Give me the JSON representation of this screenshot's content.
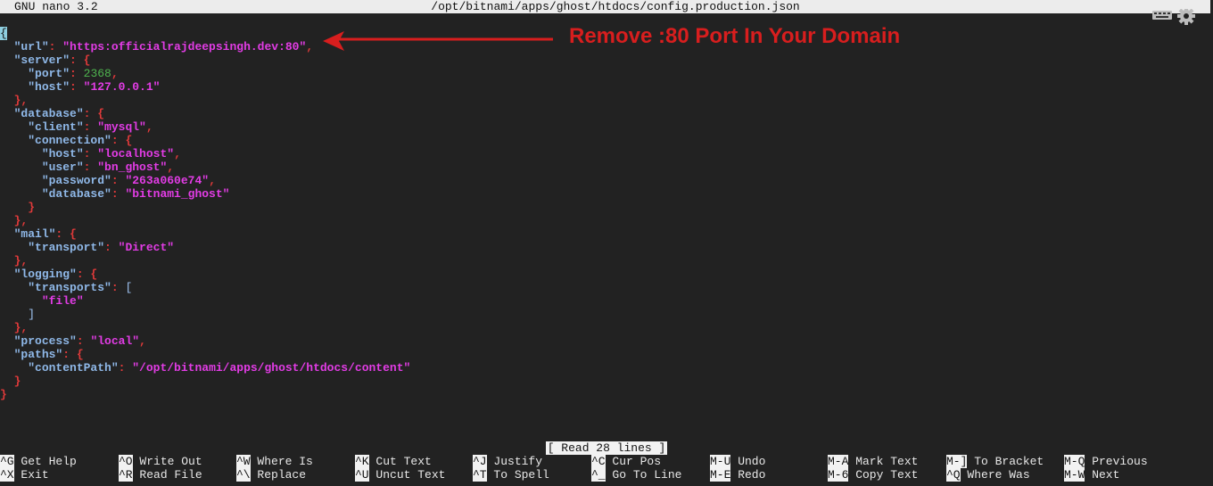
{
  "titlebar": {
    "app": "GNU nano 3.2",
    "file": "/opt/bitnami/apps/ghost/htdocs/config.production.json"
  },
  "annotation": {
    "text": "Remove :80 Port In Your Domain",
    "color": "#d81e1e"
  },
  "status_message": "[ Read 28 lines ]",
  "lines": [
    [
      {
        "t": "{",
        "c": "cur"
      }
    ],
    [
      {
        "t": "  "
      },
      {
        "t": "\"url\"",
        "c": "k"
      },
      {
        "t": ": ",
        "c": "p"
      },
      {
        "t": "\"https:officialrajdeepsingh.dev:80\"",
        "c": "s"
      },
      {
        "t": ",",
        "c": "p"
      }
    ],
    [
      {
        "t": "  "
      },
      {
        "t": "\"server\"",
        "c": "k"
      },
      {
        "t": ": {",
        "c": "p"
      }
    ],
    [
      {
        "t": "    "
      },
      {
        "t": "\"port\"",
        "c": "k"
      },
      {
        "t": ": ",
        "c": "p"
      },
      {
        "t": "2368",
        "c": "n"
      },
      {
        "t": ",",
        "c": "p"
      }
    ],
    [
      {
        "t": "    "
      },
      {
        "t": "\"host\"",
        "c": "k"
      },
      {
        "t": ": ",
        "c": "p"
      },
      {
        "t": "\"127.0.0.1\"",
        "c": "s"
      }
    ],
    [
      {
        "t": "  "
      },
      {
        "t": "},",
        "c": "p"
      }
    ],
    [
      {
        "t": "  "
      },
      {
        "t": "\"database\"",
        "c": "k"
      },
      {
        "t": ": {",
        "c": "p"
      }
    ],
    [
      {
        "t": "    "
      },
      {
        "t": "\"client\"",
        "c": "k"
      },
      {
        "t": ": ",
        "c": "p"
      },
      {
        "t": "\"mysql\"",
        "c": "s"
      },
      {
        "t": ",",
        "c": "p"
      }
    ],
    [
      {
        "t": "    "
      },
      {
        "t": "\"connection\"",
        "c": "k"
      },
      {
        "t": ": {",
        "c": "p"
      }
    ],
    [
      {
        "t": "      "
      },
      {
        "t": "\"host\"",
        "c": "k"
      },
      {
        "t": ": ",
        "c": "p"
      },
      {
        "t": "\"localhost\"",
        "c": "s"
      },
      {
        "t": ",",
        "c": "p"
      }
    ],
    [
      {
        "t": "      "
      },
      {
        "t": "\"user\"",
        "c": "k"
      },
      {
        "t": ": ",
        "c": "p"
      },
      {
        "t": "\"bn_ghost\"",
        "c": "s"
      },
      {
        "t": ",",
        "c": "p"
      }
    ],
    [
      {
        "t": "      "
      },
      {
        "t": "\"password\"",
        "c": "k"
      },
      {
        "t": ": ",
        "c": "p"
      },
      {
        "t": "\"263a060e74\"",
        "c": "s"
      },
      {
        "t": ",",
        "c": "p"
      }
    ],
    [
      {
        "t": "      "
      },
      {
        "t": "\"database\"",
        "c": "k"
      },
      {
        "t": ": ",
        "c": "p"
      },
      {
        "t": "\"bitnami_ghost\"",
        "c": "s"
      }
    ],
    [
      {
        "t": "    "
      },
      {
        "t": "}",
        "c": "p"
      }
    ],
    [
      {
        "t": "  "
      },
      {
        "t": "},",
        "c": "p"
      }
    ],
    [
      {
        "t": "  "
      },
      {
        "t": "\"mail\"",
        "c": "k"
      },
      {
        "t": ": {",
        "c": "p"
      }
    ],
    [
      {
        "t": "    "
      },
      {
        "t": "\"transport\"",
        "c": "k"
      },
      {
        "t": ": ",
        "c": "p"
      },
      {
        "t": "\"Direct\"",
        "c": "s"
      }
    ],
    [
      {
        "t": "  "
      },
      {
        "t": "},",
        "c": "p"
      }
    ],
    [
      {
        "t": "  "
      },
      {
        "t": "\"logging\"",
        "c": "k"
      },
      {
        "t": ": {",
        "c": "p"
      }
    ],
    [
      {
        "t": "    "
      },
      {
        "t": "\"transports\"",
        "c": "k"
      },
      {
        "t": ": ",
        "c": "p"
      },
      {
        "t": "[",
        "c": "b"
      }
    ],
    [
      {
        "t": "      "
      },
      {
        "t": "\"file\"",
        "c": "s"
      }
    ],
    [
      {
        "t": "    "
      },
      {
        "t": "]",
        "c": "b"
      }
    ],
    [
      {
        "t": "  "
      },
      {
        "t": "},",
        "c": "p"
      }
    ],
    [
      {
        "t": "  "
      },
      {
        "t": "\"process\"",
        "c": "k"
      },
      {
        "t": ": ",
        "c": "p"
      },
      {
        "t": "\"local\"",
        "c": "s"
      },
      {
        "t": ",",
        "c": "p"
      }
    ],
    [
      {
        "t": "  "
      },
      {
        "t": "\"paths\"",
        "c": "k"
      },
      {
        "t": ": {",
        "c": "p"
      }
    ],
    [
      {
        "t": "    "
      },
      {
        "t": "\"contentPath\"",
        "c": "k"
      },
      {
        "t": ": ",
        "c": "p"
      },
      {
        "t": "\"/opt/bitnami/apps/ghost/htdocs/content\"",
        "c": "s"
      }
    ],
    [
      {
        "t": "  "
      },
      {
        "t": "}",
        "c": "p"
      }
    ],
    [
      {
        "t": "}",
        "c": "p"
      }
    ]
  ],
  "shortcuts_row1": [
    {
      "key": "^G",
      "label": "Get Help"
    },
    {
      "key": "^O",
      "label": "Write Out"
    },
    {
      "key": "^W",
      "label": "Where Is"
    },
    {
      "key": "^K",
      "label": "Cut Text"
    },
    {
      "key": "^J",
      "label": "Justify"
    },
    {
      "key": "^C",
      "label": "Cur Pos"
    },
    {
      "key": "M-U",
      "label": "Undo"
    },
    {
      "key": "M-A",
      "label": "Mark Text"
    },
    {
      "key": "M-]",
      "label": "To Bracket"
    },
    {
      "key": "M-Q",
      "label": "Previous"
    }
  ],
  "shortcuts_row2": [
    {
      "key": "^X",
      "label": "Exit"
    },
    {
      "key": "^R",
      "label": "Read File"
    },
    {
      "key": "^\\",
      "label": "Replace"
    },
    {
      "key": "^U",
      "label": "Uncut Text"
    },
    {
      "key": "^T",
      "label": "To Spell"
    },
    {
      "key": "^_",
      "label": "Go To Line"
    },
    {
      "key": "M-E",
      "label": "Redo"
    },
    {
      "key": "M-6",
      "label": "Copy Text"
    },
    {
      "key": "^Q",
      "label": "Where Was"
    },
    {
      "key": "M-W",
      "label": "Next"
    }
  ],
  "tray_icons": [
    "keyboard-icon",
    "gear-icon"
  ]
}
